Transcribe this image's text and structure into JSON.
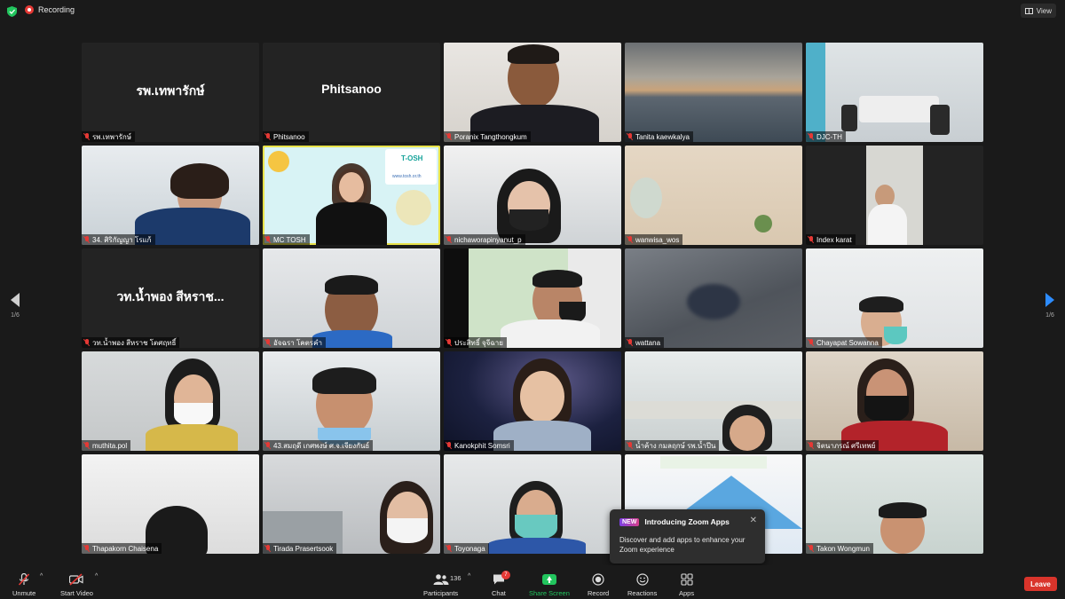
{
  "topbar": {
    "recording_label": "Recording",
    "view_label": "View"
  },
  "nav": {
    "left_page": "1/6",
    "right_page": "1/6"
  },
  "tiles": [
    {
      "name": "รพ.เทพารักษ์",
      "big": "รพ.เทพารักษ์"
    },
    {
      "name": "Phitsanoo",
      "big": "Phitsanoo"
    },
    {
      "name": "Poranix Tangthongkum"
    },
    {
      "name": "Tanita kaewkalya"
    },
    {
      "name": "DJC-TH"
    },
    {
      "name": "34. ศิริกัญญา โรแก้"
    },
    {
      "name": "MC TOSH"
    },
    {
      "name": "nichaworapinyanut_p"
    },
    {
      "name": "wanwisa_wos"
    },
    {
      "name": "Index karat"
    },
    {
      "name": "วท.น้ำพอง สีหราช โตศฤทธิ์",
      "big": "วท.น้ำพอง สีหราช..."
    },
    {
      "name": "อัจฉรา โคตรคำ"
    },
    {
      "name": "ประสิทธิ์ จุจีฉาย"
    },
    {
      "name": "wattana"
    },
    {
      "name": "Chayapat Sowanna"
    },
    {
      "name": "muthita.pol"
    },
    {
      "name": "43.สมฤดี เกศพงษ์ ศ.จ.เจียงกันธ์"
    },
    {
      "name": "Kanokphit Somsri"
    },
    {
      "name": "น้ำค้าง กมลฤกษ์ รพ.น้ำปีน"
    },
    {
      "name": "จิตนาภรณ์ ศรีเทพย์"
    },
    {
      "name": "Thapakorn Chaisena"
    },
    {
      "name": "Tirada Prasertsook"
    },
    {
      "name": "Toyonaga"
    },
    {
      "name": ""
    },
    {
      "name": "Takon Wongmun"
    }
  ],
  "mc_slide": {
    "logo_text": "T-OSH",
    "url": "www.tosh.or.th"
  },
  "toast": {
    "badge": "NEW",
    "title": "Introducing Zoom Apps",
    "text": "Discover and add apps to enhance your Zoom experience"
  },
  "toolbar": {
    "unmute": "Unmute",
    "start_video": "Start Video",
    "participants": "Participants",
    "participants_count": "136",
    "chat": "Chat",
    "chat_badge": "7",
    "share_screen": "Share Screen",
    "record": "Record",
    "reactions": "Reactions",
    "apps": "Apps",
    "leave": "Leave"
  },
  "colors": {
    "accent_blue": "#2d8cff",
    "share_green": "#22c55e",
    "leave_red": "#d9342b",
    "background": "#1a1a1a"
  }
}
